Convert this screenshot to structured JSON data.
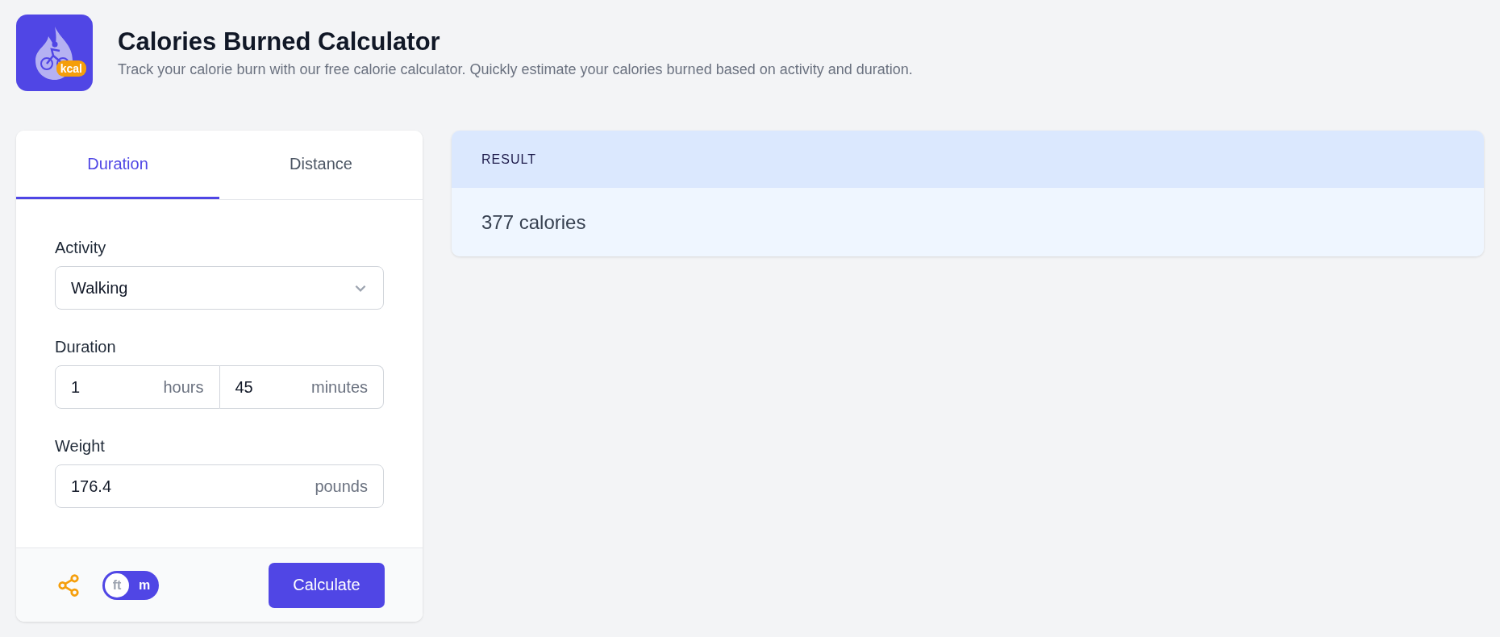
{
  "header": {
    "logo_badge": "kcal",
    "title": "Calories Burned Calculator",
    "subtitle": "Track your calorie burn with our free calorie calculator. Quickly estimate your calories burned based on activity and duration."
  },
  "tabs": [
    {
      "label": "Duration",
      "selected": true
    },
    {
      "label": "Distance",
      "selected": false
    }
  ],
  "form": {
    "activity": {
      "label": "Activity",
      "value": "Walking"
    },
    "duration": {
      "label": "Duration",
      "fields": [
        {
          "value": "1",
          "unit": "hours"
        },
        {
          "value": "45",
          "unit": "minutes"
        }
      ]
    },
    "weight": {
      "label": "Weight",
      "value": "176.4",
      "unit": "pounds"
    }
  },
  "unit_toggle": [
    {
      "label": "ft",
      "selected": true
    },
    {
      "label": "m",
      "selected": false
    }
  ],
  "calculate_button": "Calculate",
  "result": {
    "heading": "RESULT",
    "value": "377 calories"
  }
}
